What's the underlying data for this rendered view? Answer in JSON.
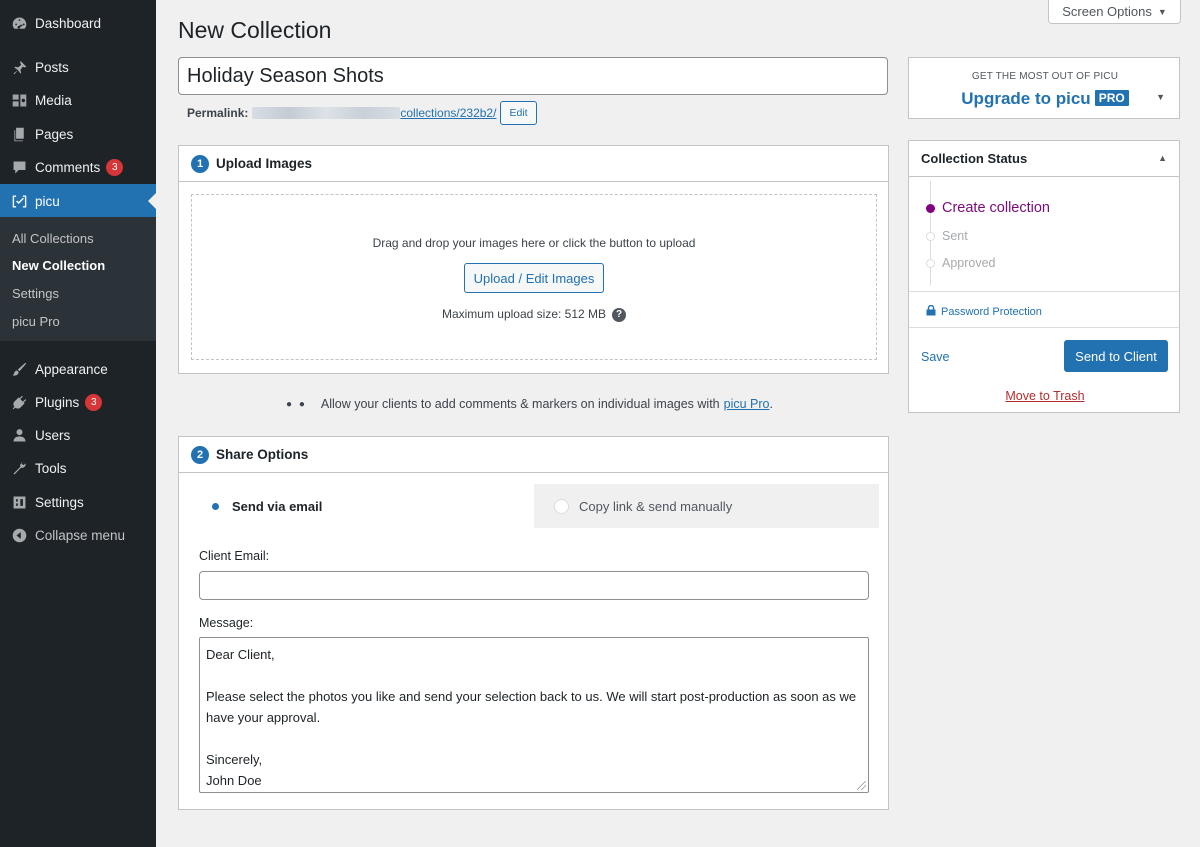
{
  "sidebar": {
    "items": [
      {
        "label": "Dashboard",
        "icon": "dashboard-icon"
      },
      {
        "label": "Posts",
        "icon": "pin-icon"
      },
      {
        "label": "Media",
        "icon": "media-icon"
      },
      {
        "label": "Pages",
        "icon": "pages-icon"
      },
      {
        "label": "Comments",
        "icon": "comment-icon",
        "badge": "3"
      },
      {
        "label": "picu",
        "icon": "picu-icon"
      },
      {
        "label": "Appearance",
        "icon": "brush-icon"
      },
      {
        "label": "Plugins",
        "icon": "plugin-icon",
        "badge": "3"
      },
      {
        "label": "Users",
        "icon": "users-icon"
      },
      {
        "label": "Tools",
        "icon": "wrench-icon"
      },
      {
        "label": "Settings",
        "icon": "settings-icon"
      },
      {
        "label": "Collapse menu",
        "icon": "collapse-icon"
      }
    ],
    "submenu": [
      "All Collections",
      "New Collection",
      "Settings",
      "picu Pro"
    ]
  },
  "screen_options": "Screen Options",
  "page_title": "New Collection",
  "collection_title": "Holiday Season Shots",
  "permalink": {
    "label": "Permalink:",
    "slug": "collections/232b2/",
    "edit_label": "Edit"
  },
  "upload": {
    "number": "1",
    "title": "Upload Images",
    "instructions": "Drag and drop your images here or click the button to upload",
    "button": "Upload / Edit Images",
    "max_size": "Maximum upload size: 512 MB",
    "help": "?"
  },
  "promo": {
    "text": "Allow your clients to add comments & markers on individual images with",
    "link": "picu Pro",
    "end": "."
  },
  "share": {
    "number": "2",
    "title": "Share Options",
    "tab_email": "Send via email",
    "tab_manual": "Copy link & send manually",
    "client_email_label": "Client Email:",
    "client_email_value": "",
    "message_label": "Message:",
    "message_lines": [
      "Dear Client,",
      "",
      "Please select the photos you like and send your selection back to us. We will start post-production as soon as we have your approval.",
      "",
      "Sincerely,",
      "John Doe"
    ]
  },
  "upgrade": {
    "small": "GET THE MOST OUT OF PICU",
    "big": "Upgrade to picu",
    "badge": "PRO"
  },
  "status": {
    "title": "Collection Status",
    "steps": [
      {
        "label": "Create collection",
        "active": true
      },
      {
        "label": "Sent",
        "active": false
      },
      {
        "label": "Approved",
        "active": false
      }
    ],
    "password_link": "Password Protection",
    "save": "Save",
    "send": "Send to Client",
    "trash": "Move to Trash"
  },
  "colors": {
    "accent": "#2271b1",
    "sidebar": "#1d2327",
    "active_step": "#800080",
    "badge": "#d63638",
    "trash": "#b32d2e"
  }
}
